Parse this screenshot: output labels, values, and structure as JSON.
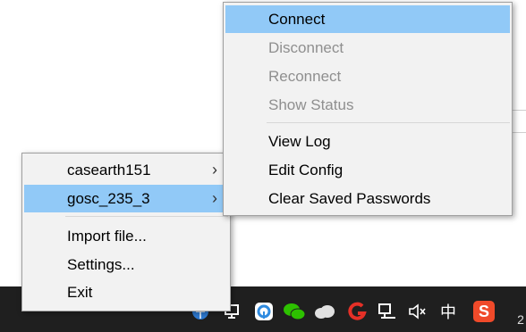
{
  "main_menu": {
    "items": [
      {
        "label": "casearth151",
        "submenu": true
      },
      {
        "label": "gosc_235_3",
        "submenu": true,
        "highlighted": true
      },
      {
        "label": "Import file..."
      },
      {
        "label": "Settings..."
      },
      {
        "label": "Exit"
      }
    ]
  },
  "submenu": {
    "items": [
      {
        "label": "Connect",
        "highlighted": true
      },
      {
        "label": "Disconnect",
        "disabled": true
      },
      {
        "label": "Reconnect",
        "disabled": true
      },
      {
        "label": "Show Status",
        "disabled": true
      },
      {
        "label": "View Log"
      },
      {
        "label": "Edit Config"
      },
      {
        "label": "Clear Saved Passwords"
      }
    ]
  },
  "tray": {
    "chevron": "^",
    "ime": "中",
    "sogou": "S",
    "clock_fragment": "2"
  },
  "colors": {
    "menu_bg": "#f2f2f2",
    "highlight": "#91c9f7",
    "disabled_text": "#8f8f8f",
    "taskbar": "#1f1f1f"
  }
}
